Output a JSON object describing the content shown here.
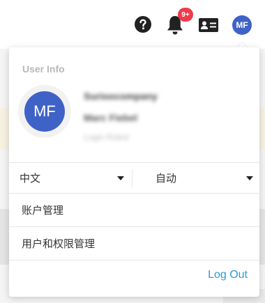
{
  "header": {
    "notification_badge": "9+",
    "avatar_initials": "MF"
  },
  "user_menu": {
    "section_title": "User Info",
    "avatar_initials": "MF",
    "company_blurred": "Surioocompany",
    "name_blurred": "Marc Fiebel",
    "role_blurred": "Login Robot",
    "language_select": "中文",
    "theme_select": "自动",
    "items": [
      {
        "label": "账户管理"
      },
      {
        "label": "用户和权限管理"
      }
    ],
    "logout_label": "Log Out"
  },
  "colors": {
    "accent": "#3f62c7",
    "badge": "#ef3b4b",
    "link": "#2b9ad6"
  },
  "icons": [
    "help-icon",
    "bell-icon",
    "id-card-icon",
    "caret-down-icon"
  ]
}
